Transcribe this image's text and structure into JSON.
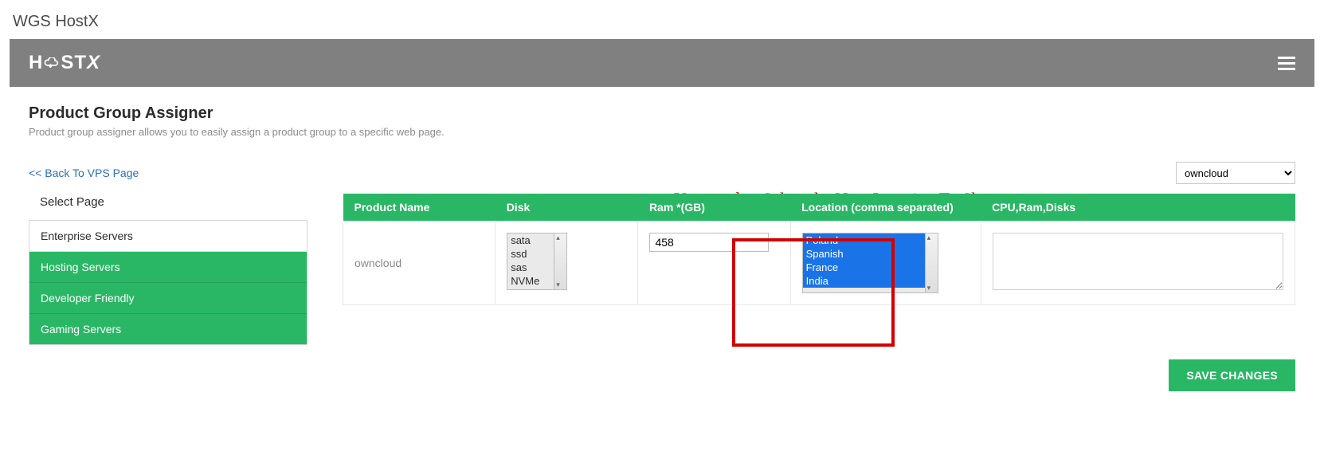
{
  "breadcrumb": "WGS HostX",
  "logo": {
    "text_before": "H",
    "text_after": "ST",
    "x": "X"
  },
  "section": {
    "title": "Product Group Assigner",
    "desc": "Product group assigner allows you to easily assign a product group to a specific web page."
  },
  "back_link": "<< Back To VPS Page",
  "select_page_label": "Select Page",
  "annotation_text": "You need to Select the New Location To Showcase",
  "dropdown_value": "owncloud",
  "pages": [
    {
      "label": "Enterprise Servers",
      "active": true
    },
    {
      "label": "Hosting Servers",
      "active": false
    },
    {
      "label": "Developer Friendly",
      "active": false
    },
    {
      "label": "Gaming Servers",
      "active": false
    }
  ],
  "table": {
    "headers": [
      "Product Name",
      "Disk",
      "Ram *(GB)",
      "Location (comma separated)",
      "CPU,Ram,Disks"
    ],
    "row": {
      "product_name": "owncloud",
      "disk_options": [
        "sata",
        "ssd",
        "sas",
        "NVMe"
      ],
      "ram_value": "458",
      "location_options": [
        "Poland",
        "Spanish",
        "France",
        "India"
      ],
      "cpu_value": ""
    }
  },
  "save_label": "SAVE CHANGES"
}
